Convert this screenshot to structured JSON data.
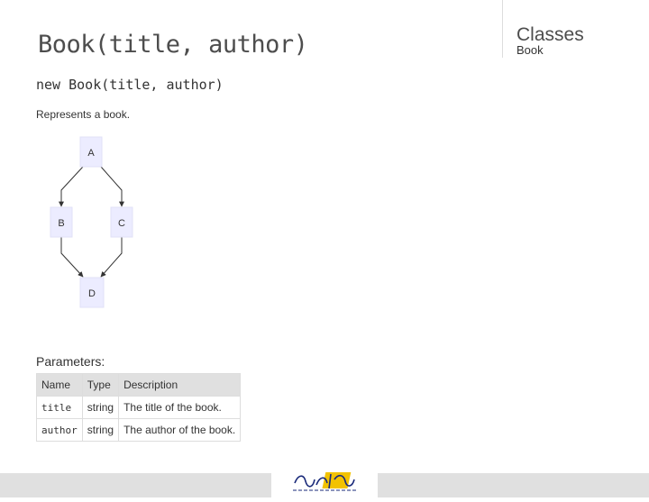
{
  "page": {
    "title": "Book(title, author)",
    "signature": "new Book(title, author)",
    "description": "Represents a book."
  },
  "sidebar": {
    "title": "Classes",
    "items": [
      {
        "label": "Book"
      }
    ]
  },
  "diagram": {
    "nodes": [
      {
        "id": "A",
        "label": "A"
      },
      {
        "id": "B",
        "label": "B"
      },
      {
        "id": "C",
        "label": "C"
      },
      {
        "id": "D",
        "label": "D"
      }
    ],
    "edges": [
      [
        "A",
        "B"
      ],
      [
        "A",
        "C"
      ],
      [
        "B",
        "D"
      ],
      [
        "C",
        "D"
      ]
    ]
  },
  "parameters": {
    "heading": "Parameters:",
    "columns": [
      "Name",
      "Type",
      "Description"
    ],
    "rows": [
      {
        "name": "title",
        "type": "string",
        "description": "The title of the book."
      },
      {
        "name": "author",
        "type": "string",
        "description": "The author of the book."
      }
    ]
  },
  "colors": {
    "node_fill": "#ececff",
    "node_stroke": "#e1e1f7",
    "table_header_bg": "#e0e0e0",
    "bottom_bar": "#e0e0e0",
    "watermark_blue": "#1a2a7a",
    "watermark_yellow": "#f2c200"
  }
}
